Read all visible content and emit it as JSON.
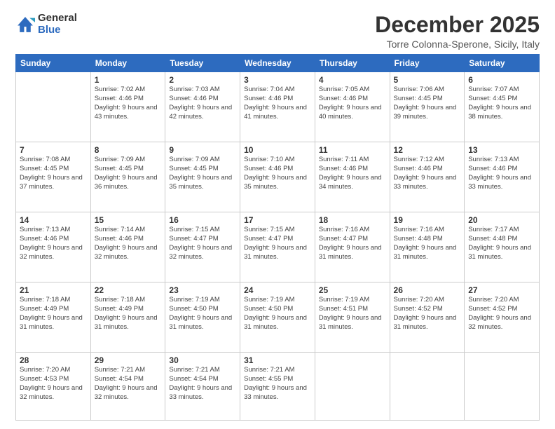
{
  "logo": {
    "general": "General",
    "blue": "Blue"
  },
  "header": {
    "month_year": "December 2025",
    "location": "Torre Colonna-Sperone, Sicily, Italy"
  },
  "weekdays": [
    "Sunday",
    "Monday",
    "Tuesday",
    "Wednesday",
    "Thursday",
    "Friday",
    "Saturday"
  ],
  "weeks": [
    [
      {
        "day": "",
        "sunrise": "",
        "sunset": "",
        "daylight": ""
      },
      {
        "day": "1",
        "sunrise": "Sunrise: 7:02 AM",
        "sunset": "Sunset: 4:46 PM",
        "daylight": "Daylight: 9 hours and 43 minutes."
      },
      {
        "day": "2",
        "sunrise": "Sunrise: 7:03 AM",
        "sunset": "Sunset: 4:46 PM",
        "daylight": "Daylight: 9 hours and 42 minutes."
      },
      {
        "day": "3",
        "sunrise": "Sunrise: 7:04 AM",
        "sunset": "Sunset: 4:46 PM",
        "daylight": "Daylight: 9 hours and 41 minutes."
      },
      {
        "day": "4",
        "sunrise": "Sunrise: 7:05 AM",
        "sunset": "Sunset: 4:46 PM",
        "daylight": "Daylight: 9 hours and 40 minutes."
      },
      {
        "day": "5",
        "sunrise": "Sunrise: 7:06 AM",
        "sunset": "Sunset: 4:45 PM",
        "daylight": "Daylight: 9 hours and 39 minutes."
      },
      {
        "day": "6",
        "sunrise": "Sunrise: 7:07 AM",
        "sunset": "Sunset: 4:45 PM",
        "daylight": "Daylight: 9 hours and 38 minutes."
      }
    ],
    [
      {
        "day": "7",
        "sunrise": "Sunrise: 7:08 AM",
        "sunset": "Sunset: 4:45 PM",
        "daylight": "Daylight: 9 hours and 37 minutes."
      },
      {
        "day": "8",
        "sunrise": "Sunrise: 7:09 AM",
        "sunset": "Sunset: 4:45 PM",
        "daylight": "Daylight: 9 hours and 36 minutes."
      },
      {
        "day": "9",
        "sunrise": "Sunrise: 7:09 AM",
        "sunset": "Sunset: 4:45 PM",
        "daylight": "Daylight: 9 hours and 35 minutes."
      },
      {
        "day": "10",
        "sunrise": "Sunrise: 7:10 AM",
        "sunset": "Sunset: 4:46 PM",
        "daylight": "Daylight: 9 hours and 35 minutes."
      },
      {
        "day": "11",
        "sunrise": "Sunrise: 7:11 AM",
        "sunset": "Sunset: 4:46 PM",
        "daylight": "Daylight: 9 hours and 34 minutes."
      },
      {
        "day": "12",
        "sunrise": "Sunrise: 7:12 AM",
        "sunset": "Sunset: 4:46 PM",
        "daylight": "Daylight: 9 hours and 33 minutes."
      },
      {
        "day": "13",
        "sunrise": "Sunrise: 7:13 AM",
        "sunset": "Sunset: 4:46 PM",
        "daylight": "Daylight: 9 hours and 33 minutes."
      }
    ],
    [
      {
        "day": "14",
        "sunrise": "Sunrise: 7:13 AM",
        "sunset": "Sunset: 4:46 PM",
        "daylight": "Daylight: 9 hours and 32 minutes."
      },
      {
        "day": "15",
        "sunrise": "Sunrise: 7:14 AM",
        "sunset": "Sunset: 4:46 PM",
        "daylight": "Daylight: 9 hours and 32 minutes."
      },
      {
        "day": "16",
        "sunrise": "Sunrise: 7:15 AM",
        "sunset": "Sunset: 4:47 PM",
        "daylight": "Daylight: 9 hours and 32 minutes."
      },
      {
        "day": "17",
        "sunrise": "Sunrise: 7:15 AM",
        "sunset": "Sunset: 4:47 PM",
        "daylight": "Daylight: 9 hours and 31 minutes."
      },
      {
        "day": "18",
        "sunrise": "Sunrise: 7:16 AM",
        "sunset": "Sunset: 4:47 PM",
        "daylight": "Daylight: 9 hours and 31 minutes."
      },
      {
        "day": "19",
        "sunrise": "Sunrise: 7:16 AM",
        "sunset": "Sunset: 4:48 PM",
        "daylight": "Daylight: 9 hours and 31 minutes."
      },
      {
        "day": "20",
        "sunrise": "Sunrise: 7:17 AM",
        "sunset": "Sunset: 4:48 PM",
        "daylight": "Daylight: 9 hours and 31 minutes."
      }
    ],
    [
      {
        "day": "21",
        "sunrise": "Sunrise: 7:18 AM",
        "sunset": "Sunset: 4:49 PM",
        "daylight": "Daylight: 9 hours and 31 minutes."
      },
      {
        "day": "22",
        "sunrise": "Sunrise: 7:18 AM",
        "sunset": "Sunset: 4:49 PM",
        "daylight": "Daylight: 9 hours and 31 minutes."
      },
      {
        "day": "23",
        "sunrise": "Sunrise: 7:19 AM",
        "sunset": "Sunset: 4:50 PM",
        "daylight": "Daylight: 9 hours and 31 minutes."
      },
      {
        "day": "24",
        "sunrise": "Sunrise: 7:19 AM",
        "sunset": "Sunset: 4:50 PM",
        "daylight": "Daylight: 9 hours and 31 minutes."
      },
      {
        "day": "25",
        "sunrise": "Sunrise: 7:19 AM",
        "sunset": "Sunset: 4:51 PM",
        "daylight": "Daylight: 9 hours and 31 minutes."
      },
      {
        "day": "26",
        "sunrise": "Sunrise: 7:20 AM",
        "sunset": "Sunset: 4:52 PM",
        "daylight": "Daylight: 9 hours and 31 minutes."
      },
      {
        "day": "27",
        "sunrise": "Sunrise: 7:20 AM",
        "sunset": "Sunset: 4:52 PM",
        "daylight": "Daylight: 9 hours and 32 minutes."
      }
    ],
    [
      {
        "day": "28",
        "sunrise": "Sunrise: 7:20 AM",
        "sunset": "Sunset: 4:53 PM",
        "daylight": "Daylight: 9 hours and 32 minutes."
      },
      {
        "day": "29",
        "sunrise": "Sunrise: 7:21 AM",
        "sunset": "Sunset: 4:54 PM",
        "daylight": "Daylight: 9 hours and 32 minutes."
      },
      {
        "day": "30",
        "sunrise": "Sunrise: 7:21 AM",
        "sunset": "Sunset: 4:54 PM",
        "daylight": "Daylight: 9 hours and 33 minutes."
      },
      {
        "day": "31",
        "sunrise": "Sunrise: 7:21 AM",
        "sunset": "Sunset: 4:55 PM",
        "daylight": "Daylight: 9 hours and 33 minutes."
      },
      {
        "day": "",
        "sunrise": "",
        "sunset": "",
        "daylight": ""
      },
      {
        "day": "",
        "sunrise": "",
        "sunset": "",
        "daylight": ""
      },
      {
        "day": "",
        "sunrise": "",
        "sunset": "",
        "daylight": ""
      }
    ]
  ]
}
